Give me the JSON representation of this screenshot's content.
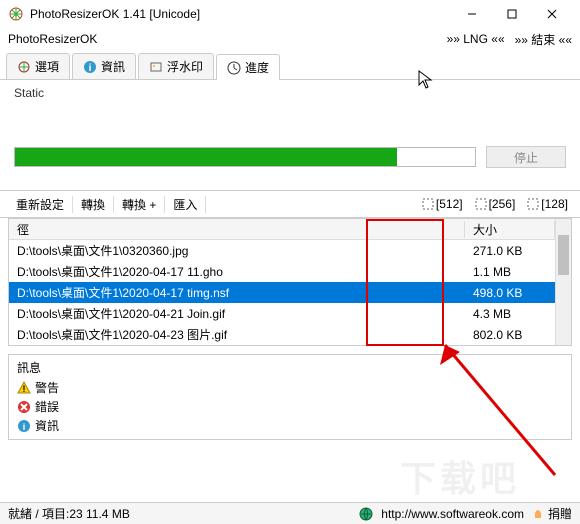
{
  "window": {
    "title": "PhotoResizerOK 1.41 [Unicode]"
  },
  "menu": {
    "app": "PhotoResizerOK",
    "lang": "»» LNG ««",
    "end": "»» 結束 ««"
  },
  "tabs": {
    "options": "選項",
    "info": "資訊",
    "watermark": "浮水印",
    "progress": "進度"
  },
  "static_label": "Static",
  "progress": {
    "stop": "停止"
  },
  "toolbar": {
    "reset": "重新設定",
    "convert": "轉換",
    "convert_plus": "轉換 +",
    "import": "匯入",
    "zoom": [
      "[512]",
      "[256]",
      "[128]"
    ]
  },
  "table": {
    "col_path": "徑",
    "col_size": "大小",
    "rows": [
      {
        "path": "D:\\tools\\桌面\\文件1\\0320360.jpg",
        "size": "271.0 KB",
        "selected": false
      },
      {
        "path": "D:\\tools\\桌面\\文件1\\2020-04-17 11.gho",
        "size": "1.1 MB",
        "selected": false
      },
      {
        "path": "D:\\tools\\桌面\\文件1\\2020-04-17 timg.nsf",
        "size": "498.0 KB",
        "selected": true
      },
      {
        "path": "D:\\tools\\桌面\\文件1\\2020-04-21 Join.gif",
        "size": "4.3 MB",
        "selected": false
      },
      {
        "path": "D:\\tools\\桌面\\文件1\\2020-04-23 图片.gif",
        "size": "802.0 KB",
        "selected": false
      }
    ]
  },
  "info": {
    "title": "訊息",
    "warning": "警告",
    "error": "錯誤",
    "detail": "資訊"
  },
  "status": {
    "text": "就緒 / 項目:23 11.4 MB",
    "url": "http://www.softwareok.com",
    "donate": "捐贈"
  }
}
